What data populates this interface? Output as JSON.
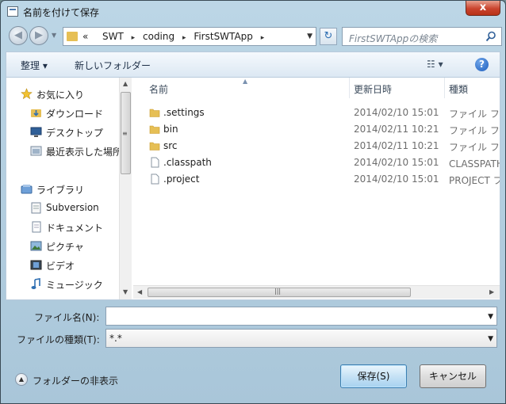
{
  "window": {
    "title": "名前を付けて保存",
    "close_glyph": "x"
  },
  "address_bar": {
    "back_glyph": "◀",
    "forward_glyph": "▶",
    "prefix_glyph": "«",
    "crumbs": [
      "SWT",
      "coding",
      "FirstSWTApp"
    ],
    "search_placeholder": "FirstSWTAppの検索"
  },
  "toolbar": {
    "organize_label": "整理 ▾",
    "new_folder_label": "新しいフォルダー",
    "view_glyph": "☷ ▾",
    "help_glyph": "?"
  },
  "nav": {
    "items": [
      {
        "label": "お気に入り",
        "icon": "star-icon"
      },
      {
        "label": "ダウンロード",
        "icon": "download-folder-icon"
      },
      {
        "label": "デスクトップ",
        "icon": "desktop-icon"
      },
      {
        "label": "最近表示した場所",
        "icon": "recent-places-icon"
      },
      {
        "label": "ライブラリ",
        "icon": "library-icon"
      },
      {
        "label": "Subversion",
        "icon": "document-icon"
      },
      {
        "label": "ドキュメント",
        "icon": "documents-icon"
      },
      {
        "label": "ピクチャ",
        "icon": "pictures-icon"
      },
      {
        "label": "ビデオ",
        "icon": "videos-icon"
      },
      {
        "label": "ミュージック",
        "icon": "music-icon"
      }
    ]
  },
  "file_list": {
    "columns": {
      "name": "名前",
      "date": "更新日時",
      "type": "種類"
    },
    "rows": [
      {
        "name": ".settings",
        "date": "2014/02/10 15:01",
        "type": "ファイル フォルダー",
        "icon": "folder-icon"
      },
      {
        "name": "bin",
        "date": "2014/02/11 10:21",
        "type": "ファイル フォルダー",
        "icon": "folder-icon"
      },
      {
        "name": "src",
        "date": "2014/02/11 10:21",
        "type": "ファイル フォルダー",
        "icon": "folder-icon"
      },
      {
        "name": ".classpath",
        "date": "2014/02/10 15:01",
        "type": "CLASSPATH ファイル",
        "icon": "file-icon"
      },
      {
        "name": ".project",
        "date": "2014/02/10 15:01",
        "type": "PROJECT ファイル",
        "icon": "file-icon"
      }
    ]
  },
  "form": {
    "filename_label": "ファイル名(N):",
    "filename_value": "",
    "filetype_label": "ファイルの種類(T):",
    "filetype_value": "*.*"
  },
  "footer": {
    "hide_folders_label": "フォルダーの非表示",
    "save_label": "保存(S)",
    "cancel_label": "キャンセル"
  },
  "colors": {
    "accent": "#3c7fb1",
    "folder": "#e6bf55",
    "close": "#c9442e"
  }
}
